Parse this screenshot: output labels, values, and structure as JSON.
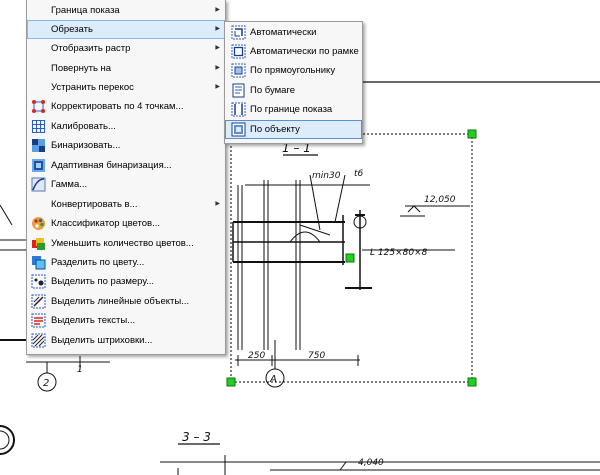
{
  "menu": {
    "items": [
      {
        "label": "Граница показа",
        "submenu": true
      },
      {
        "label": "Обрезать",
        "submenu": true,
        "highlighted": true
      },
      {
        "label": "Отобразить растр",
        "submenu": true
      },
      {
        "label": "Повернуть на",
        "submenu": true
      },
      {
        "label": "Устранить перекос",
        "submenu": true
      },
      {
        "label": "Корректировать по 4 точкам...",
        "icon": "four-points-icon"
      },
      {
        "label": "Калибровать...",
        "icon": "calibrate-grid-icon"
      },
      {
        "label": "Бинаризовать...",
        "icon": "binarize-icon"
      },
      {
        "label": "Адаптивная бинаризация...",
        "icon": "adaptive-binarize-icon"
      },
      {
        "label": "Гамма...",
        "icon": "gamma-icon"
      },
      {
        "label": "Конвертировать в...",
        "submenu": true
      },
      {
        "label": "Классификатор цветов...",
        "icon": "palette-icon"
      },
      {
        "label": "Уменьшить количество цветов...",
        "icon": "reduce-colors-icon"
      },
      {
        "label": "Разделить по цвету...",
        "icon": "split-color-icon"
      },
      {
        "label": "Выделить по размеру...",
        "icon": "select-by-size-icon"
      },
      {
        "label": "Выделить линейные объекты...",
        "icon": "select-lines-icon"
      },
      {
        "label": "Выделить тексты...",
        "icon": "select-texts-icon"
      },
      {
        "label": "Выделить штриховки...",
        "icon": "select-hatching-icon"
      }
    ]
  },
  "submenu": {
    "items": [
      {
        "label": "Автоматически",
        "icon": "crop-auto-icon"
      },
      {
        "label": "Автоматически по рамке",
        "icon": "crop-frame-icon"
      },
      {
        "label": "По прямоугольнику",
        "icon": "crop-rectangle-icon"
      },
      {
        "label": "По бумаге",
        "icon": "crop-paper-icon"
      },
      {
        "label": "По границе показа",
        "icon": "crop-display-border-icon"
      },
      {
        "label": "По объекту",
        "icon": "crop-object-icon",
        "highlighted": true
      }
    ]
  },
  "drawing": {
    "section_1": "1 – 1",
    "label_min30": "min30",
    "label_t6": "t6",
    "elevation_1": "12,050",
    "profile": "L 125×80×8",
    "dim_250": "250",
    "dim_750": "750",
    "axis_A": "А",
    "axis_2": "2",
    "mark_1": "1",
    "section_3": "3 – 3",
    "elevation_2": "4,040"
  },
  "colors": {
    "menu_bg": "#f7f7f7",
    "highlight": "#dcecfc",
    "highlight_border": "#86b7ea",
    "handle": "#22cc22"
  }
}
